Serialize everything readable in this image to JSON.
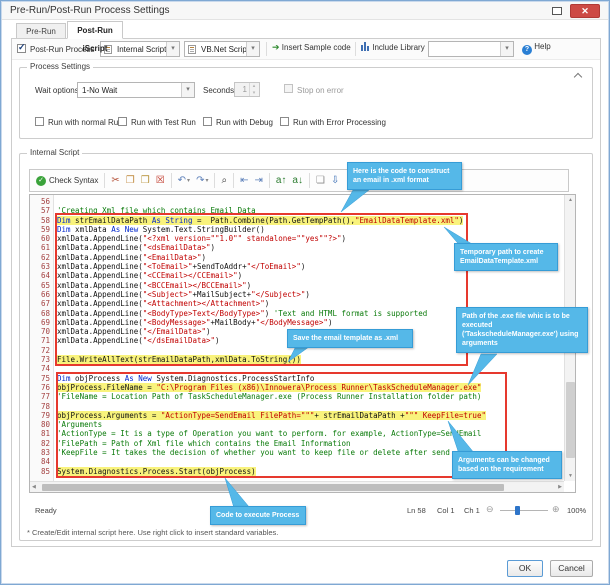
{
  "window": {
    "title": "Pre-Run/Post-Run Process Settings"
  },
  "tabs": [
    {
      "label": "Pre-Run iScript",
      "active": false
    },
    {
      "label": "Post-Run iScript",
      "active": true
    }
  ],
  "toolbar": {
    "post_run_process_label": "Post-Run Process",
    "script_type_value": "Internal Script",
    "language_value": "VB.Net Script",
    "insert_sample_label": "Insert Sample code",
    "include_library_label": "Include Library",
    "include_library_value": "",
    "help_label": "Help"
  },
  "process_settings": {
    "title": "Process Settings",
    "wait_options_label": "Wait options",
    "wait_options_value": "1-No Wait",
    "seconds_label": "Seconds",
    "seconds_value": "1",
    "stop_on_error_label": "Stop on error",
    "run_checkboxes": [
      "Run with normal Run",
      "Run with Test Run",
      "Run with Debug",
      "Run with Error Processing"
    ]
  },
  "internal_script": {
    "title": "Internal Script",
    "editor_toolbar": {
      "check_syntax_label": "Check Syntax",
      "groups": [
        [
          "cut",
          "copy",
          "paste",
          "delete-selection"
        ],
        [
          "undo",
          "redo"
        ],
        [
          "find"
        ],
        [
          "outdent",
          "indent"
        ],
        [
          "to-uppercase",
          "to-lowercase"
        ],
        [
          "new-script",
          "import-script",
          "export-script",
          "clear-script",
          "fullscreen"
        ]
      ]
    },
    "code_lines": [
      {
        "n": 56,
        "seg": []
      },
      {
        "n": 57,
        "seg": [
          [
            "c",
            "'Creating Xml file which contains Email Data"
          ]
        ]
      },
      {
        "n": 58,
        "hl": true,
        "seg": [
          [
            "k",
            "Dim"
          ],
          [
            "t",
            " strEmailDataPath "
          ],
          [
            "k",
            "As"
          ],
          [
            "t",
            " "
          ],
          [
            "k",
            "String"
          ],
          [
            "t",
            " =  Path.Combine(Path.GetTempPath(),"
          ],
          [
            "s",
            "\"EmailDataTemplate.xml\""
          ],
          [
            "t",
            ")"
          ]
        ]
      },
      {
        "n": 59,
        "seg": [
          [
            "k",
            "Dim"
          ],
          [
            "t",
            " xmlData "
          ],
          [
            "k",
            "As"
          ],
          [
            "t",
            " "
          ],
          [
            "k",
            "New"
          ],
          [
            "t",
            " System.Text.StringBuilder()"
          ]
        ]
      },
      {
        "n": 60,
        "seg": [
          [
            "t",
            "xmlData.AppendLine("
          ],
          [
            "s",
            "\"<?xml version=\"\"1.0\"\" standalone=\"\"yes\"\"?>\""
          ],
          [
            "t",
            ")"
          ]
        ]
      },
      {
        "n": 61,
        "seg": [
          [
            "t",
            "xmlData.AppendLine("
          ],
          [
            "s",
            "\"<dsEmailData>\""
          ],
          [
            "t",
            ")"
          ]
        ]
      },
      {
        "n": 62,
        "seg": [
          [
            "t",
            "xmlData.AppendLine("
          ],
          [
            "s",
            "\"<EmailData>\""
          ],
          [
            "t",
            ")"
          ]
        ]
      },
      {
        "n": 63,
        "seg": [
          [
            "t",
            "xmlData.AppendLine("
          ],
          [
            "s",
            "\"<ToEmail>\""
          ],
          [
            "t",
            "+SendToAddr+"
          ],
          [
            "s",
            "\"</ToEmail>\""
          ],
          [
            "t",
            ")"
          ]
        ]
      },
      {
        "n": 64,
        "seg": [
          [
            "t",
            "xmlData.AppendLine("
          ],
          [
            "s",
            "\"<CCEmail></CCEmail>\""
          ],
          [
            "t",
            ")"
          ]
        ]
      },
      {
        "n": 65,
        "seg": [
          [
            "t",
            "xmlData.AppendLine("
          ],
          [
            "s",
            "\"<BCCEmail></BCCEmail>\""
          ],
          [
            "t",
            ")"
          ]
        ]
      },
      {
        "n": 66,
        "seg": [
          [
            "t",
            "xmlData.AppendLine("
          ],
          [
            "s",
            "\"<Subject>\""
          ],
          [
            "t",
            "+MailSubject+"
          ],
          [
            "s",
            "\"</Subject>\""
          ],
          [
            "t",
            ")"
          ]
        ]
      },
      {
        "n": 67,
        "seg": [
          [
            "t",
            "xmlData.AppendLine("
          ],
          [
            "s",
            "\"<Attachment></Attachment>\""
          ],
          [
            "t",
            ")"
          ]
        ]
      },
      {
        "n": 68,
        "seg": [
          [
            "t",
            "xmlData.AppendLine("
          ],
          [
            "s",
            "\"<BodyType>Text</BodyType>\""
          ],
          [
            "t",
            ") "
          ],
          [
            "c",
            "'Text and HTML format is supported"
          ]
        ]
      },
      {
        "n": 69,
        "seg": [
          [
            "t",
            "xmlData.AppendLine("
          ],
          [
            "s",
            "\"<BodyMessage>\""
          ],
          [
            "t",
            "+MailBody+"
          ],
          [
            "s",
            "\"</BodyMessage>\""
          ],
          [
            "t",
            ")"
          ]
        ]
      },
      {
        "n": 70,
        "seg": [
          [
            "t",
            "xmlData.AppendLine("
          ],
          [
            "s",
            "\"</EmailData>\""
          ],
          [
            "t",
            ")"
          ]
        ]
      },
      {
        "n": 71,
        "seg": [
          [
            "t",
            "xmlData.AppendLine("
          ],
          [
            "s",
            "\"</dsEmailData>\""
          ],
          [
            "t",
            ")"
          ]
        ]
      },
      {
        "n": 72,
        "seg": []
      },
      {
        "n": 73,
        "hl": true,
        "seg": [
          [
            "t",
            "File.WriteAllText(strEmailDataPath,xmlData.ToString())"
          ]
        ]
      },
      {
        "n": 74,
        "seg": []
      },
      {
        "n": 75,
        "seg": [
          [
            "k",
            "Dim"
          ],
          [
            "t",
            " objProcess "
          ],
          [
            "k",
            "As"
          ],
          [
            "t",
            " "
          ],
          [
            "k",
            "New"
          ],
          [
            "t",
            " System.Diagnostics.ProcessStartInfo"
          ]
        ]
      },
      {
        "n": 76,
        "hl": true,
        "seg": [
          [
            "t",
            "objProcess.FileName = "
          ],
          [
            "s",
            "\"C:\\Program Files (x86)\\Innowera\\Process Runner\\TaskScheduleManager.exe\""
          ]
        ]
      },
      {
        "n": 77,
        "seg": [
          [
            "c",
            "'FileName = Location Path of TaskScheduleManager.exe (Process Runner Installation folder path)"
          ]
        ]
      },
      {
        "n": 78,
        "seg": []
      },
      {
        "n": 79,
        "hl": true,
        "seg": [
          [
            "t",
            "objProcess.Arguments = "
          ],
          [
            "s",
            "\"ActionType=SendEmail FilePath=\"\"\""
          ],
          [
            "t",
            "+ strEmailDataPath +"
          ],
          [
            "s",
            "\"\"\" KeepFile=true\""
          ]
        ]
      },
      {
        "n": 80,
        "seg": [
          [
            "c",
            "'Arguments"
          ]
        ]
      },
      {
        "n": 81,
        "seg": [
          [
            "c",
            "'ActionType = It is a type of Operation you want to perform. for example, ActionType=SendEmail"
          ]
        ]
      },
      {
        "n": 82,
        "seg": [
          [
            "c",
            "'FilePath = Path of Xml file which contains the Email Information"
          ]
        ]
      },
      {
        "n": 83,
        "seg": [
          [
            "c",
            "'KeepFile = It takes the decision of whether you want to keep file or delete after send"
          ]
        ]
      },
      {
        "n": 84,
        "seg": []
      },
      {
        "n": 85,
        "hl": true,
        "seg": [
          [
            "t",
            "System.Diagnostics.Process.Start(objProcess)"
          ]
        ]
      }
    ],
    "callouts": [
      "Here is the code to construct an email in .xml format",
      "Temporary path to create EmailDataTemplate.xml",
      "Path of the .exe file whic is to be executed ('TaskscheduleManager.exe') using arguments",
      "Save the email template as .xml",
      "Arguments can be changed based on the requirement",
      "Code to execute Process"
    ],
    "status": {
      "ready": "Ready",
      "ln": "Ln 58",
      "col": "Col 1",
      "ch": "Ch 1",
      "zoom": "100%"
    },
    "footnote": "* Create/Edit internal script here. Use right click to insert standard variables."
  },
  "footer": {
    "ok_label": "OK",
    "cancel_label": "Cancel"
  },
  "colors": {
    "accent": "#55b8e8",
    "annotation_box": "#e6392e",
    "code_highlight": "#f9f37c",
    "keyword": "#0026cc",
    "string": "#c00000",
    "comment": "#0a7a0a",
    "close_button": "#cd4a45"
  }
}
